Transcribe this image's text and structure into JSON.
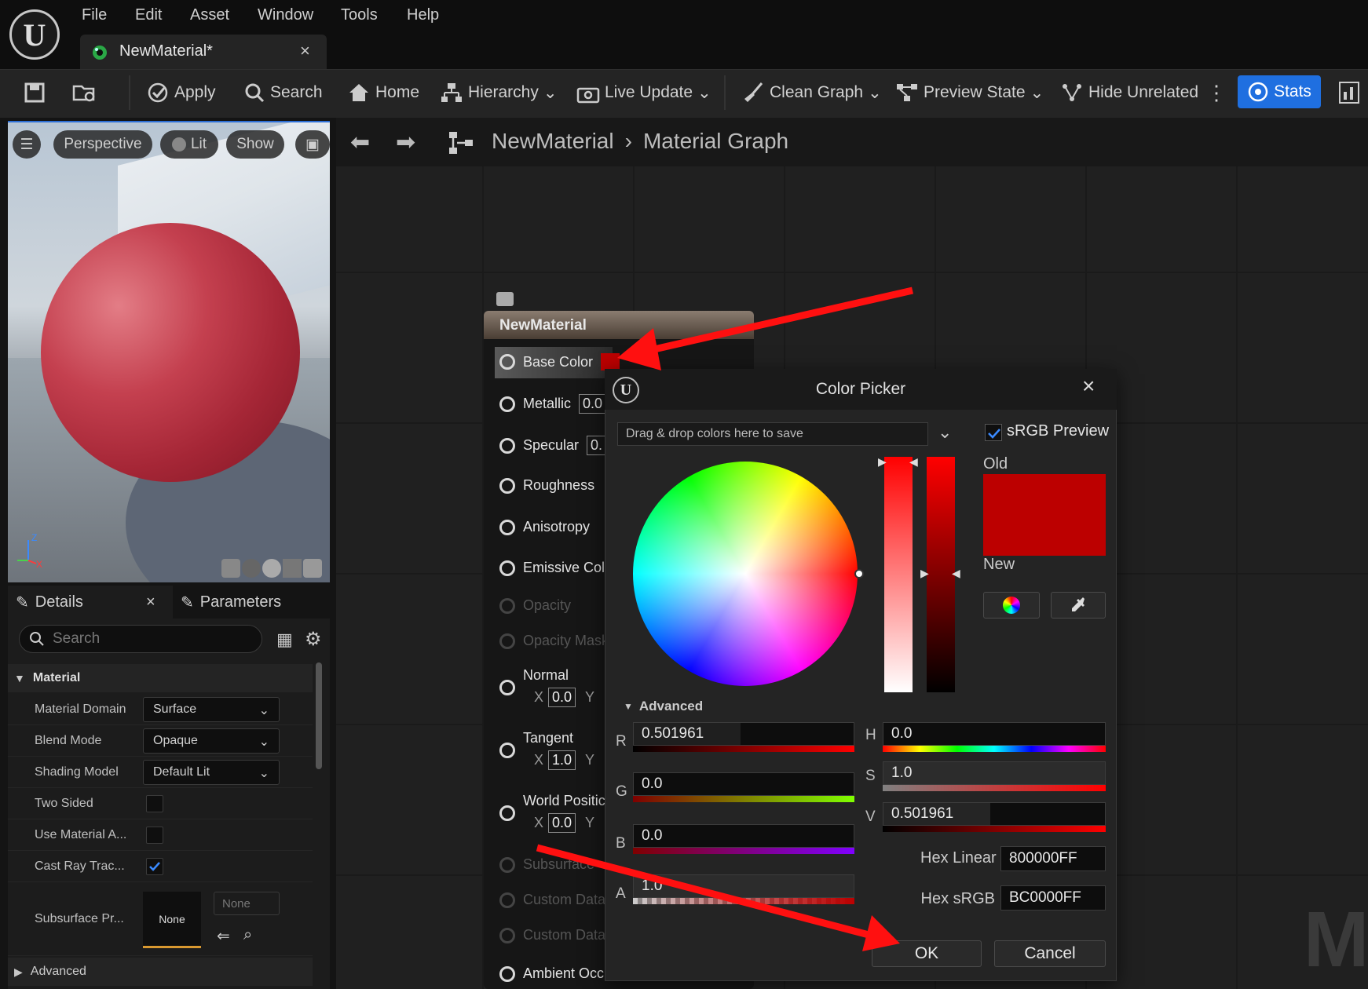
{
  "menu": [
    "File",
    "Edit",
    "Asset",
    "Window",
    "Tools",
    "Help"
  ],
  "document_tab": {
    "title": "NewMaterial*"
  },
  "toolbar": {
    "apply": "Apply",
    "search": "Search",
    "home": "Home",
    "hierarchy": "Hierarchy",
    "live_update": "Live Update",
    "clean_graph": "Clean Graph",
    "preview_state": "Preview State",
    "hide_unrelated": "Hide Unrelated",
    "stats": "Stats"
  },
  "viewport": {
    "perspective": "Perspective",
    "lit": "Lit",
    "show": "Show",
    "axis_z": "Z",
    "axis_x": "X"
  },
  "details": {
    "tab_details": "Details",
    "tab_parameters": "Parameters",
    "search_placeholder": "Search",
    "section_material": "Material",
    "section_advanced": "Advanced",
    "rows": [
      {
        "label": "Material Domain",
        "value": "Surface"
      },
      {
        "label": "Blend Mode",
        "value": "Opaque"
      },
      {
        "label": "Shading Model",
        "value": "Default Lit"
      },
      {
        "label": "Two Sided",
        "checked": false
      },
      {
        "label": "Use Material A...",
        "checked": false
      },
      {
        "label": "Cast Ray Trac...",
        "checked": true
      },
      {
        "label": "Subsurface Pr...",
        "thumb": "None",
        "combo": "None"
      }
    ]
  },
  "graph": {
    "crumb_asset": "NewMaterial",
    "crumb_graph": "Material Graph",
    "watermark": "MA",
    "node": {
      "title": "NewMaterial",
      "pins": [
        {
          "label": "Base Color",
          "active": true
        },
        {
          "label": "Metallic",
          "value": "0.0"
        },
        {
          "label": "Specular",
          "value": "0."
        },
        {
          "label": "Roughness"
        },
        {
          "label": "Anisotropy"
        },
        {
          "label": "Emissive Col"
        },
        {
          "label": "Opacity",
          "dim": true
        },
        {
          "label": "Opacity Mask",
          "dim": true
        },
        {
          "label": "Normal",
          "x": "0.0"
        },
        {
          "label": "Tangent",
          "x": "1.0"
        },
        {
          "label": "World Positic",
          "x": "0.0"
        },
        {
          "label": "Subsurface",
          "dim": true
        },
        {
          "label": "Custom Data",
          "dim": true
        },
        {
          "label": "Custom Data",
          "dim": true
        },
        {
          "label": "Ambient Occ"
        }
      ],
      "x_label": "X",
      "y_label": "Y"
    }
  },
  "color_picker": {
    "title": "Color Picker",
    "drop_hint": "Drag & drop colors here to save",
    "srgb_preview": "sRGB Preview",
    "srgb_checked": true,
    "old_label": "Old",
    "new_label": "New",
    "old_color": "#bc0000",
    "new_color": "#bc0000",
    "advanced": "Advanced",
    "R": "0.501961",
    "G": "0.0",
    "B": "0.0",
    "A": "1.0",
    "H": "0.0",
    "S": "1.0",
    "V": "0.501961",
    "hex_linear_label": "Hex Linear",
    "hex_linear": "800000FF",
    "hex_srgb_label": "Hex sRGB",
    "hex_srgb": "BC0000FF",
    "ok": "OK",
    "cancel": "Cancel",
    "channel_labels": {
      "r": "R",
      "g": "G",
      "b": "B",
      "a": "A",
      "h": "H",
      "s": "S",
      "v": "V"
    }
  },
  "annotation_color": "#ff1010",
  "accent_color": "#1f6fe0"
}
